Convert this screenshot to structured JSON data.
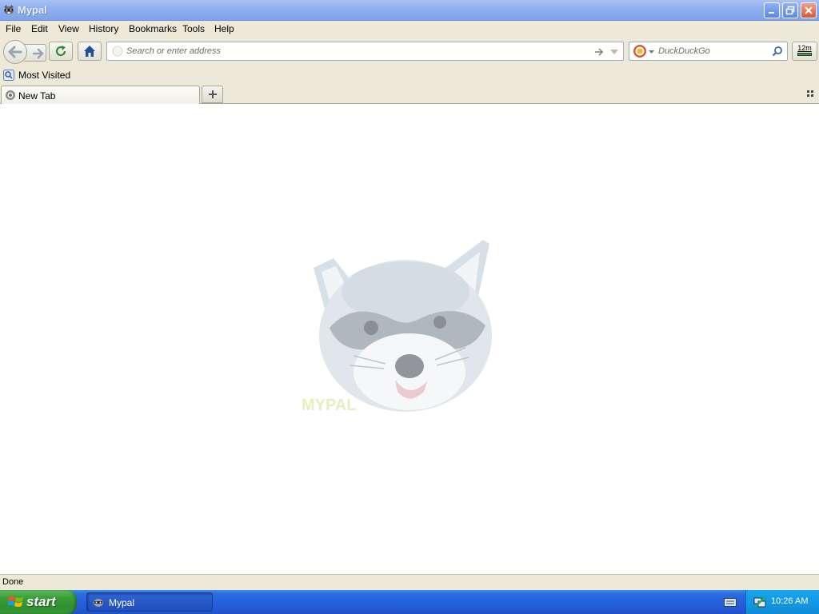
{
  "window": {
    "title": "Mypal",
    "controls": [
      "minimize",
      "restore",
      "close"
    ]
  },
  "menu": {
    "items": [
      {
        "label": "File"
      },
      {
        "label": "Edit"
      },
      {
        "label": "View"
      },
      {
        "label": "History"
      },
      {
        "label": "Bookmarks"
      },
      {
        "label": "Tools"
      },
      {
        "label": "Help"
      }
    ]
  },
  "toolbar": {
    "url_placeholder": "Search or enter address",
    "url_value": "",
    "search_engine": "DuckDuckGo",
    "search_placeholder": "DuckDuckGo",
    "extension_badge": "12m"
  },
  "bookmarks": {
    "items": [
      {
        "label": "Most Visited"
      }
    ]
  },
  "tabs": {
    "items": [
      {
        "label": "New Tab",
        "active": true
      }
    ]
  },
  "content": {
    "logo_text": "MYPAL"
  },
  "status": {
    "text": "Done"
  },
  "taskbar": {
    "start_label": "start",
    "items": [
      {
        "label": "Mypal"
      }
    ],
    "clock": "10:26 AM"
  },
  "colors": {
    "title_bar": "#8fb0ef",
    "chrome": "#ece9d8",
    "taskbar": "#245ddb",
    "start_button": "#3c9f3c",
    "tray": "#0f8cd8"
  }
}
